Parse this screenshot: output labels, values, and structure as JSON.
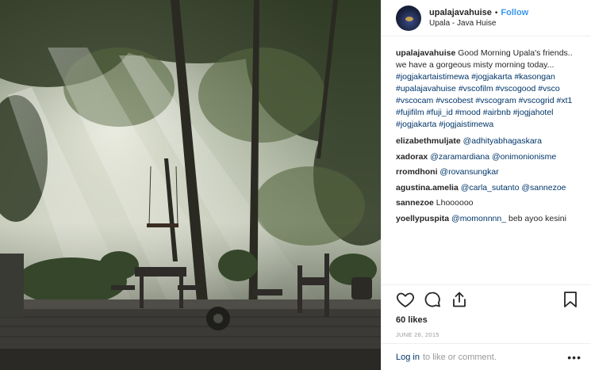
{
  "header": {
    "username": "upalajavahuise",
    "separator": "•",
    "follow_label": "Follow",
    "location": "Upala - Java Huise"
  },
  "caption": {
    "author": "upalajavahuise",
    "text": "Good Morning Upala's friends.. we have a gorgeous misty morning today...",
    "hashtags": [
      "#jogjakartaistimewa",
      "#jogjakarta",
      "#kasongan",
      "#upalajavahuise",
      "#vscofilm",
      "#vscogood",
      "#vsco",
      "#vscocam",
      "#vscobest",
      "#vscogram",
      "#vscogrid",
      "#xt1",
      "#fujifilm",
      "#fuji_id",
      "#mood",
      "#airbnb",
      "#jogjahotel",
      "#jogjakarta",
      "#jogjaistimewa"
    ]
  },
  "comments": [
    {
      "user": "elizabethmuljate",
      "mentions": [
        "@adhityabhagaskara"
      ],
      "text": ""
    },
    {
      "user": "xadorax",
      "mentions": [
        "@zaramardiana",
        "@onimonionisme"
      ],
      "text": ""
    },
    {
      "user": "rromdhoni",
      "mentions": [
        "@rovansungkar"
      ],
      "text": ""
    },
    {
      "user": "agustina.amelia",
      "mentions": [
        "@carla_sutanto",
        "@sannezoe"
      ],
      "text": ""
    },
    {
      "user": "sannezoe",
      "mentions": [],
      "text": "Lhoooooo"
    },
    {
      "user": "yoellypuspita",
      "mentions": [
        "@momonnnn_"
      ],
      "text": "beb ayoo kesini"
    }
  ],
  "actions": {
    "icons": [
      "heart-icon",
      "comment-icon",
      "share-icon",
      "bookmark-icon"
    ]
  },
  "likes_label": "60 likes",
  "date_label": "JUNE 26, 2015",
  "footer": {
    "login_link": "Log in",
    "login_suffix": "to like or comment.",
    "more_label": "•••"
  }
}
